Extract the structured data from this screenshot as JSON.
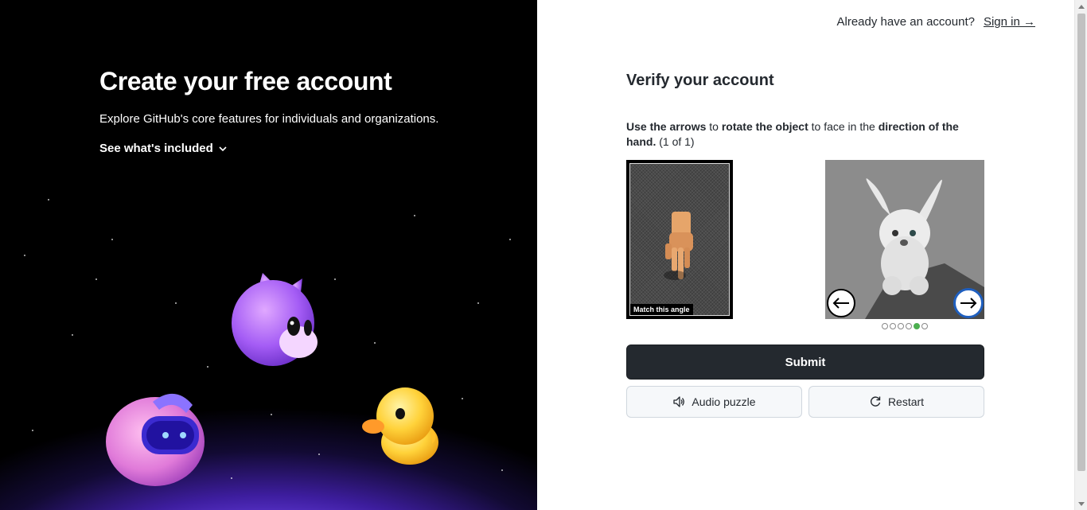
{
  "hero": {
    "headline": "Create your free account",
    "subhead": "Explore GitHub's core features for individuals and organizations.",
    "included_link": "See what's included"
  },
  "header": {
    "already_text": "Already have an account?",
    "sign_in": "Sign in →"
  },
  "verify": {
    "title": "Verify your account",
    "instr_use": "Use the arrows",
    "instr_to1": " to ",
    "instr_rotate": "rotate the object",
    "instr_to2": " to face in the ",
    "instr_direction": "direction of the hand.",
    "instr_count": " (1 of 1)",
    "match_label": "Match this angle",
    "progress": {
      "total": 6,
      "current": 5
    },
    "submit": "Submit",
    "audio": "Audio puzzle",
    "restart": "Restart"
  },
  "colors": {
    "accent_dark": "#24292f",
    "dot_active": "#4caf50",
    "arrow_focus": "#1f5fbf"
  },
  "icons": {
    "chevron": "chevron-down-icon",
    "audio": "speaker-icon",
    "restart": "refresh-icon",
    "left": "arrow-left-icon",
    "right": "arrow-right-icon"
  }
}
